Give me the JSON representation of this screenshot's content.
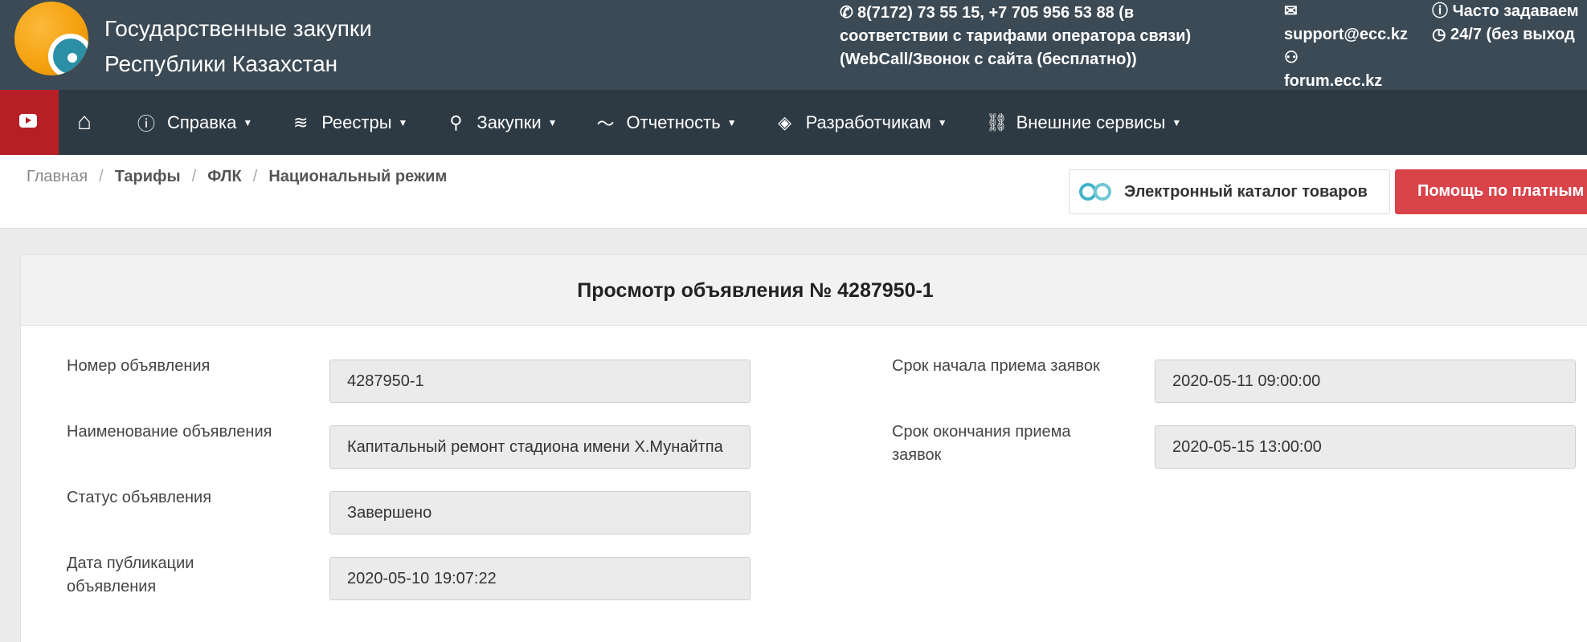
{
  "header": {
    "site_title_line1": "Государственные закупки",
    "site_title_line2": "Республики Казахстан",
    "phone_line1": "8(7172) 73 55 15, +7 705 956 53 88 (в",
    "phone_line2": "соответствии с тарифами оператора связи)",
    "phone_line3": "(WebCall/Звонок с сайта (бесплатно))",
    "email": "support@ecc.kz",
    "forum": "forum.ecc.kz",
    "faq": "Часто задаваем",
    "hours": "24/7 (без выход"
  },
  "nav": {
    "items": [
      {
        "label": "Справка",
        "icon": "help-circle-icon"
      },
      {
        "label": "Реестры",
        "icon": "layers-icon"
      },
      {
        "label": "Закупки",
        "icon": "search-icon"
      },
      {
        "label": "Отчетность",
        "icon": "chart-line-icon"
      },
      {
        "label": "Разработчикам",
        "icon": "tag-icon"
      },
      {
        "label": "Внешние сервисы",
        "icon": "link-icon"
      }
    ]
  },
  "breadcrumb": {
    "home": "Главная",
    "tariffs": "Тарифы",
    "flk": "ФЛК",
    "current": "Национальный режим"
  },
  "buttons": {
    "catalog": "Электронный каталог товаров",
    "help": "Помощь по платным"
  },
  "card": {
    "title": "Просмотр объявления № 4287950-1",
    "left": [
      {
        "label": "Номер объявления",
        "value": "4287950-1"
      },
      {
        "label": "Наименование объявления",
        "value": "Капитальный ремонт стадиона имени Х.Мунайтпа"
      },
      {
        "label": "Статус объявления",
        "value": "Завершено"
      },
      {
        "label_line1": "Дата публикации",
        "label_line2": "объявления",
        "value": "2020-05-10 19:07:22"
      }
    ],
    "right": [
      {
        "label": "Срок начала приема заявок",
        "value": "2020-05-11 09:00:00"
      },
      {
        "label_line1": "Срок окончания приема",
        "label_line2": "заявок",
        "value": "2020-05-15 13:00:00"
      }
    ]
  },
  "colors": {
    "topbar": "#3b4a55",
    "navbar": "#2e3a43",
    "youtube": "#b61f26",
    "help_button": "#d9434a"
  }
}
